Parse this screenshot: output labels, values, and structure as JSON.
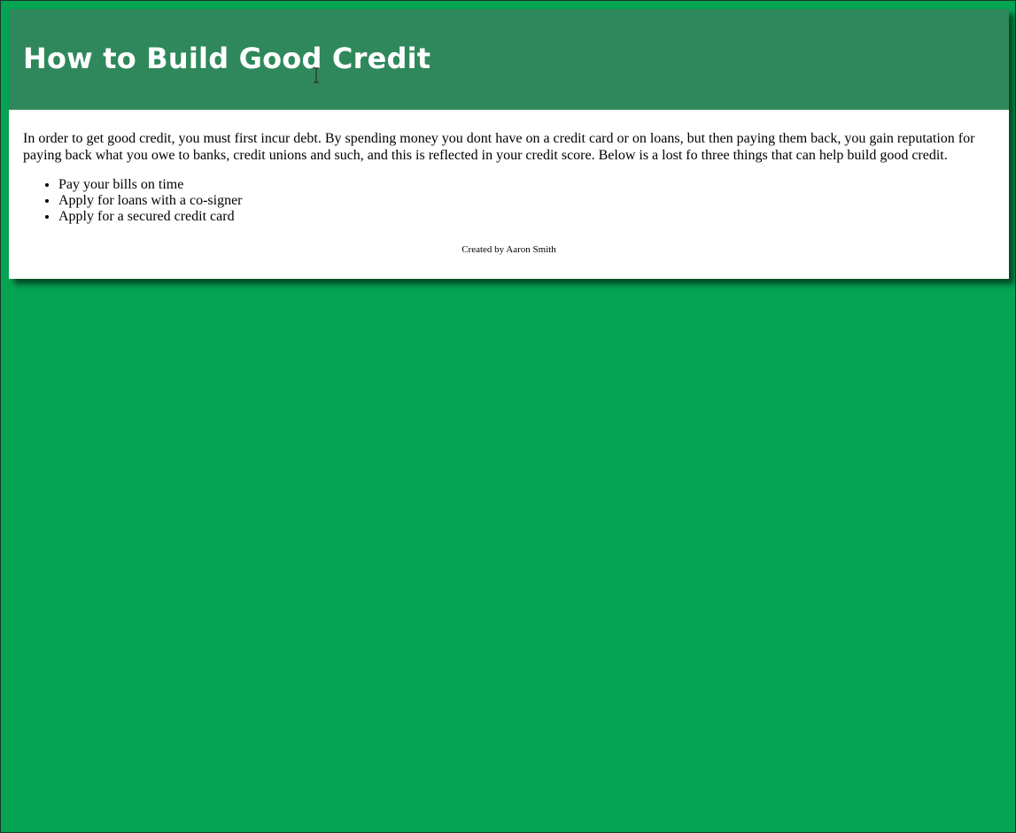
{
  "header": {
    "title": "How to Build Good Credit"
  },
  "main": {
    "intro": "In order to get good credit, you must first incur debt. By spending money you dont have on a credit card or on loans, but then paying them back, you gain reputation for paying back what you owe to banks, credit unions and such, and this is reflected in your credit score. Below is a lost fo three things that can help build good credit.",
    "tips": [
      "Pay your bills on time",
      "Apply for loans with a co-signer",
      "Apply for a secured credit card"
    ]
  },
  "footer": {
    "credit": "Created by Aaron Smith"
  },
  "colors": {
    "background": "#04a452",
    "header": "#2f885b",
    "card": "#ffffff"
  },
  "icons": {
    "cursor": "text-cursor-icon"
  }
}
